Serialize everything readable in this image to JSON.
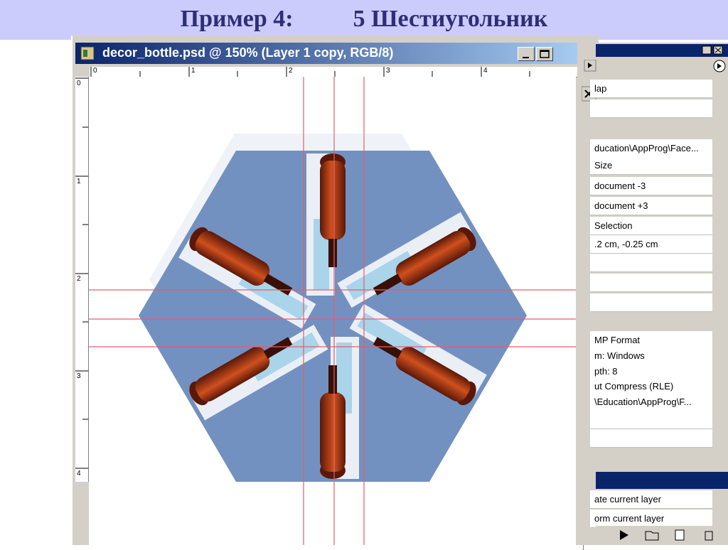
{
  "slide": {
    "title_part1": "Пример 4:",
    "title_part2": "5 Шестиугольник"
  },
  "document": {
    "title": "decor_bottle.psd @ 150% (Layer 1 copy, RGB/8)",
    "ruler_top_numbers": [
      "0",
      "1",
      "2",
      "3",
      "4"
    ],
    "ruler_left_numbers": [
      "0",
      "1",
      "2",
      "3",
      "4"
    ]
  },
  "canvas": {
    "hexagon_color": "#7391c0",
    "guide_color": "#e0606a",
    "bottle_color": "#c0441c"
  },
  "history_panel": {
    "items": [
      "lap",
      "",
      "ducation\\AppProg\\Face...",
      "Size",
      "document -3",
      "document +3",
      "Selection",
      ".2 cm, -0.25 cm",
      "",
      "",
      "",
      "MP Format",
      "m: Windows",
      "pth: 8",
      "ut Compress (RLE)",
      "\\Education\\AppProg\\F...",
      "",
      "",
      "ate current layer",
      "orm current layer"
    ]
  },
  "icons": [
    "photoshop-doc-icon",
    "minimize-icon",
    "maximize-icon",
    "close-icon",
    "history-menu-icon",
    "play-icon",
    "folder-icon",
    "new-layer-icon",
    "trash-icon"
  ]
}
